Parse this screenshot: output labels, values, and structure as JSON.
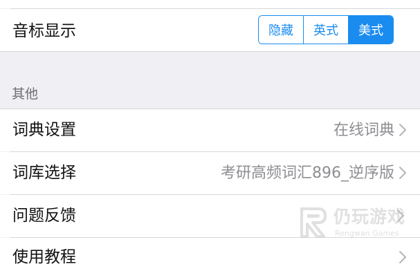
{
  "phonetic": {
    "label": "音标显示",
    "options": [
      "隐藏",
      "英式",
      "美式"
    ],
    "selected": "美式"
  },
  "section_other": {
    "header": "其他"
  },
  "rows": [
    {
      "label": "词典设置",
      "value": "在线词典"
    },
    {
      "label": "词库选择",
      "value": "考研高频词汇896_逆序版"
    },
    {
      "label": "问题反馈",
      "value": ""
    },
    {
      "label": "使用教程",
      "value": ""
    }
  ],
  "watermark": {
    "title": "仍玩游戏",
    "subtitle": "Rengwan Games"
  },
  "colors": {
    "accent": "#1a8cf0",
    "background": "#f0f0f4",
    "value_text": "#8e8e93"
  }
}
